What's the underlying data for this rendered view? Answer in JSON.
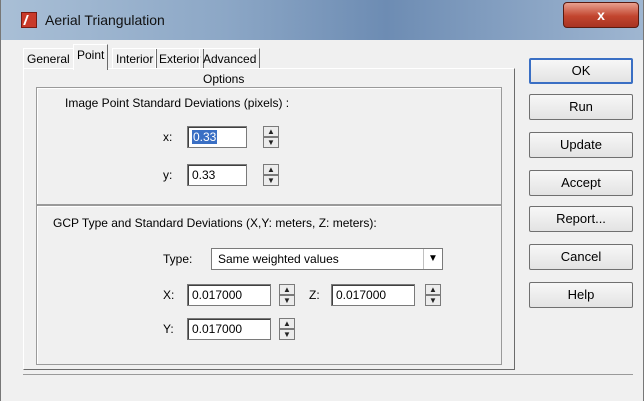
{
  "window": {
    "title": "Aerial Triangulation",
    "close_glyph": "x"
  },
  "tabs": [
    {
      "label": "General"
    },
    {
      "label": "Point"
    },
    {
      "label": "Interior"
    },
    {
      "label": "Exterior"
    },
    {
      "label": "Advanced Options"
    }
  ],
  "active_tab": "Point",
  "image_point": {
    "heading": "Image Point Standard Deviations (pixels) :",
    "x_label": "x:",
    "x_value": "0.33",
    "y_label": "y:",
    "y_value": "0.33"
  },
  "gcp": {
    "heading": "GCP Type and Standard Deviations (X,Y: meters, Z: meters):",
    "type_label": "Type:",
    "type_value": "Same weighted values",
    "x_label": "X:",
    "x_value": "0.017000",
    "z_label": "Z:",
    "z_value": "0.017000",
    "y_label": "Y:",
    "y_value": "0.017000"
  },
  "buttons": {
    "ok": "OK",
    "run": "Run",
    "update": "Update",
    "accept": "Accept",
    "report": "Report...",
    "cancel": "Cancel",
    "help": "Help"
  },
  "icons": {
    "spin_up": "▲",
    "spin_down": "▼",
    "dropdown_arrow": "▼"
  }
}
